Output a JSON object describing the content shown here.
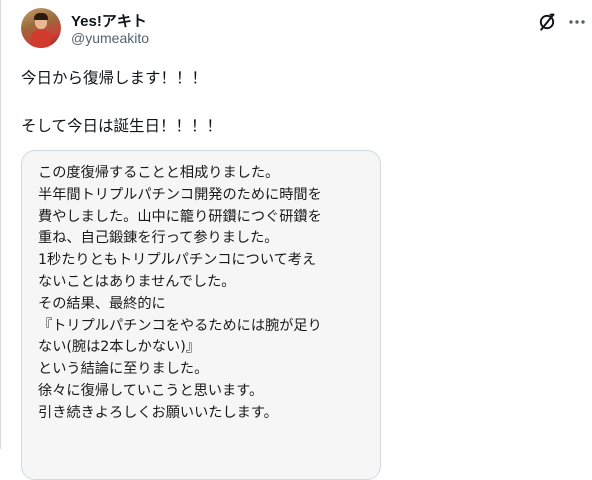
{
  "user": {
    "display_name": "Yes!アキト",
    "handle": "@yumeakito"
  },
  "icons": {
    "grok": "grok-icon",
    "more": "more-options-icon",
    "avatar": "avatar"
  },
  "post": {
    "lines": [
      "今日から復帰します！！！",
      "",
      "そして今日は誕生日！！！！"
    ]
  },
  "image_card": {
    "lines": [
      "この度復帰することと相成りました。",
      "半年間トリプルパチンコ開発のために時間を",
      "費やしました。山中に籠り研鑽につぐ研鑽を",
      "重ね、自己鍛錬を行って参りました。",
      "1秒たりともトリプルパチンコについて考え",
      "ないことはありませんでした。",
      "その結果、最終的に",
      "『トリプルパチンコをやるためには腕が足り",
      "ない(腕は2本しかない)』",
      "という結論に至りました。",
      "徐々に復帰していこうと思います。",
      "引き続きよろしくお願いいたします。"
    ]
  }
}
